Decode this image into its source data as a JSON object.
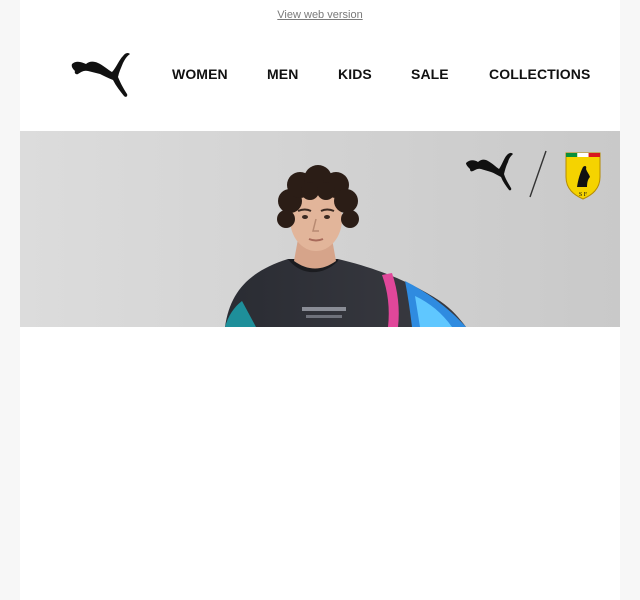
{
  "topbar": {
    "web_version_link": "View web version"
  },
  "brand": {
    "logo_icon": "puma-cat-logo-icon",
    "accent_color": "#111111"
  },
  "nav": {
    "items": [
      {
        "label": "WOMEN"
      },
      {
        "label": "MEN"
      },
      {
        "label": "KIDS"
      },
      {
        "label": "SALE"
      },
      {
        "label": "COLLECTIONS"
      }
    ]
  },
  "hero": {
    "background_color": "#d2d2d2",
    "logos": [
      "puma-cat-logo-icon",
      "ferrari-shield-icon"
    ],
    "subject": "model-photo"
  }
}
